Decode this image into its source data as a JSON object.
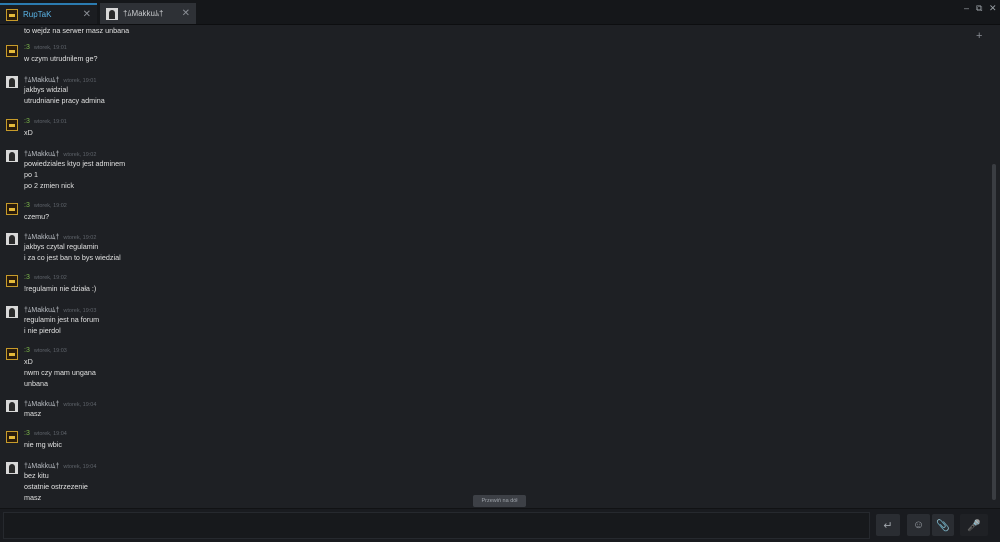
{
  "tabs": [
    {
      "label": "RupTaK",
      "close": "✕"
    },
    {
      "label": "†ﾑMakkuﾑ†",
      "close": "✕"
    }
  ],
  "window_controls": {
    "minimize": "–",
    "maximize": "⧉",
    "close": "✕"
  },
  "header_action": "+",
  "top_line": "to wejdz na serwer masz unbana",
  "messages": [
    {
      "author": ":3",
      "time": "wtorek, 19:01",
      "lines": [
        "w czym utrudnilem ge?"
      ]
    },
    {
      "author": "†ﾑMakkuﾑ†",
      "time": "wtorek, 19:01",
      "lines": [
        "jakbys widzial",
        "utrudnianie pracy admina"
      ]
    },
    {
      "author": ":3",
      "time": "wtorek, 19:01",
      "lines": [
        "xD"
      ]
    },
    {
      "author": "†ﾑMakkuﾑ†",
      "time": "wtorek, 19:02",
      "lines": [
        "powiedziales ktyo jest adminem",
        "po 1",
        "po 2 zmien nick"
      ]
    },
    {
      "author": ":3",
      "time": "wtorek, 19:02",
      "lines": [
        "czemu?"
      ]
    },
    {
      "author": "†ﾑMakkuﾑ†",
      "time": "wtorek, 19:02",
      "lines": [
        "jakbys czytal regulamin",
        "i za co jest ban to bys wiedzial"
      ]
    },
    {
      "author": ":3",
      "time": "wtorek, 19:02",
      "lines": [
        "!regulamin nie działa :)"
      ]
    },
    {
      "author": "†ﾑMakkuﾑ†",
      "time": "wtorek, 19:03",
      "lines": [
        "regulamin jest na forum",
        "i nie pierdol"
      ]
    },
    {
      "author": ":3",
      "time": "wtorek, 19:03",
      "lines": [
        "xD",
        "nwm czy mam ungana",
        "unbana"
      ]
    },
    {
      "author": "†ﾑMakkuﾑ†",
      "time": "wtorek, 19:04",
      "lines": [
        "masz"
      ]
    },
    {
      "author": ":3",
      "time": "wtorek, 19:04",
      "lines": [
        "nie mg wbic"
      ]
    },
    {
      "author": "†ﾑMakkuﾑ†",
      "time": "wtorek, 19:04",
      "lines": [
        "bez kitu",
        "ostatnie ostrzezenie",
        "masz"
      ]
    }
  ],
  "jump_button": "Przewiń na dół",
  "composer": {
    "send_icon": "↵",
    "emoji_icon": "☺",
    "attach_icon": "📎",
    "voice_icon": "🎤"
  }
}
